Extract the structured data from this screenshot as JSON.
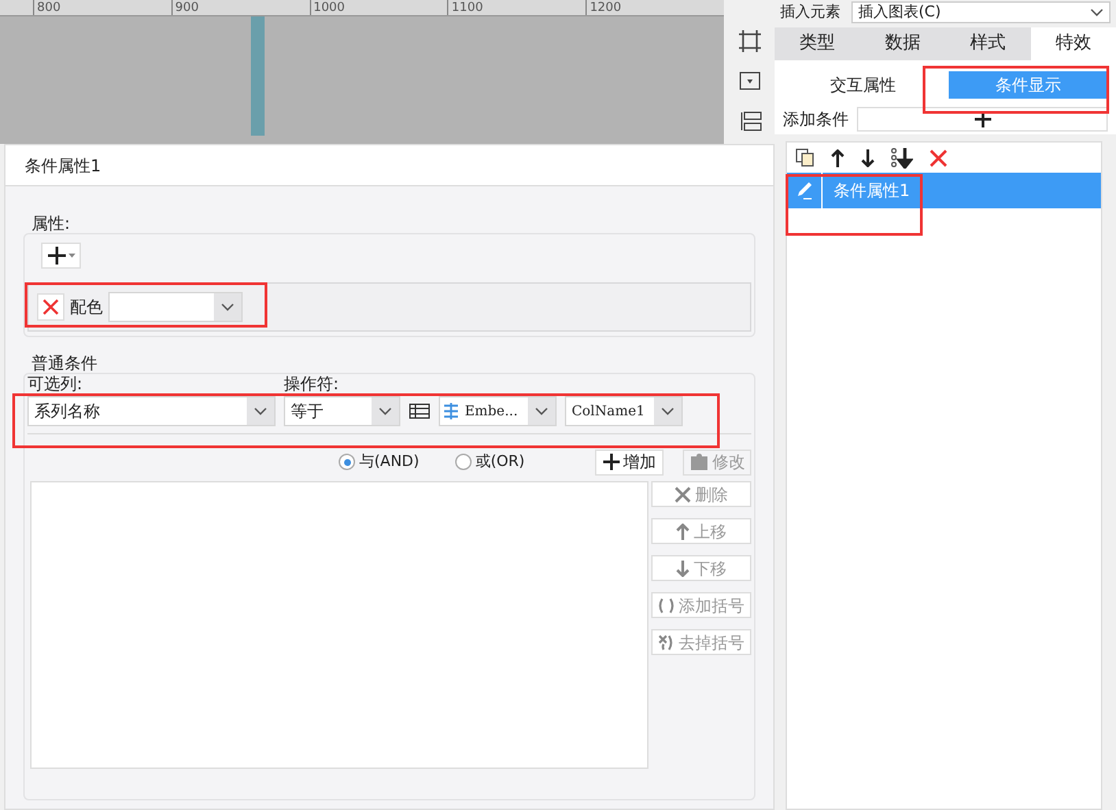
{
  "ruler": {
    "labels": [
      "800",
      "900",
      "1000",
      "1100",
      "1200"
    ]
  },
  "insert_bar": {
    "label": "插入元素",
    "dropdown": "插入图表(C)"
  },
  "tabs": [
    {
      "label": "类型",
      "selected": false
    },
    {
      "label": "数据",
      "selected": false
    },
    {
      "label": "样式",
      "selected": false
    },
    {
      "label": "特效",
      "selected": true
    }
  ],
  "subtabs": [
    {
      "label": "交互属性",
      "selected": false
    },
    {
      "label": "条件显示",
      "selected": true
    }
  ],
  "add_condition": {
    "label": "添加条件"
  },
  "condition_list": {
    "items": [
      {
        "label": "条件属性1",
        "selected": true
      }
    ]
  },
  "dialog": {
    "title": "条件属性1",
    "attributes": {
      "legend": "属性:",
      "items": [
        {
          "label": "配色"
        }
      ]
    },
    "conditions": {
      "legend": "普通条件",
      "column_label": "可选列:",
      "operator_label": "操作符:",
      "column_value": "系列名称",
      "operator_value": "等于",
      "source_value": "Embe...",
      "field_value": "ColName1",
      "logic": [
        {
          "label": "与(AND)",
          "selected": true
        },
        {
          "label": "或(OR)",
          "selected": false
        }
      ],
      "buttons": [
        {
          "label": "增加",
          "kind": "add",
          "disabled": false
        },
        {
          "label": "修改",
          "kind": "edit",
          "disabled": true
        }
      ],
      "side_buttons": [
        {
          "label": "删除",
          "kind": "delete",
          "disabled": true
        },
        {
          "label": "上移",
          "kind": "up",
          "disabled": true
        },
        {
          "label": "下移",
          "kind": "down",
          "disabled": true
        },
        {
          "label": "添加括号",
          "kind": "add-bracket",
          "disabled": true
        },
        {
          "label": "去掉括号",
          "kind": "remove-bracket",
          "disabled": true
        }
      ]
    }
  }
}
